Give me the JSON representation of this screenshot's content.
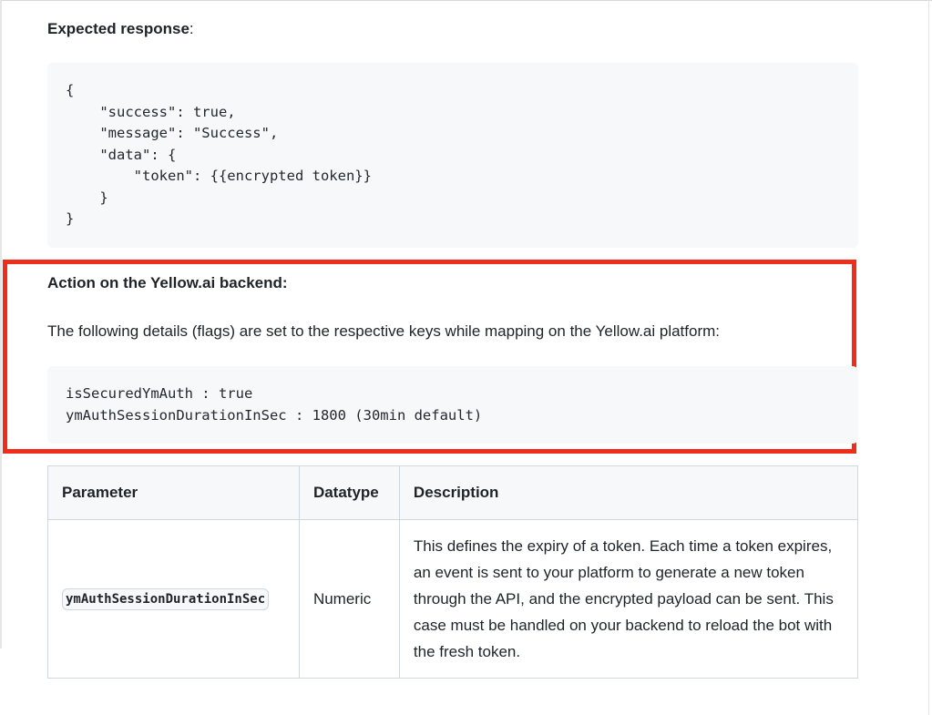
{
  "expected": {
    "label": "Expected response",
    "colon": ":"
  },
  "code_response": "{\n    \"success\": true,\n    \"message\": \"Success\",\n    \"data\": {\n        \"token\": {{encrypted token}}\n    }\n}",
  "backend": {
    "heading": "Action on the Yellow.ai backend:",
    "paragraph": "The following details (flags) are set to the respective keys while mapping on the Yellow.ai platform:",
    "code": "isSecuredYmAuth : true\nymAuthSessionDurationInSec : 1800 (30min default)",
    "highlight_color": "#ee2d1a"
  },
  "table": {
    "headers": [
      "Parameter",
      "Datatype",
      "Description"
    ],
    "rows": [
      {
        "parameter": "ymAuthSessionDurationInSec",
        "datatype": "Numeric",
        "description": "This defines the expiry of a token. Each time a token expires, an event is sent to your platform to generate a new token through the API, and the encrypted payload can be sent. This case must be handled on your backend to reload the bot with the fresh token."
      }
    ]
  }
}
